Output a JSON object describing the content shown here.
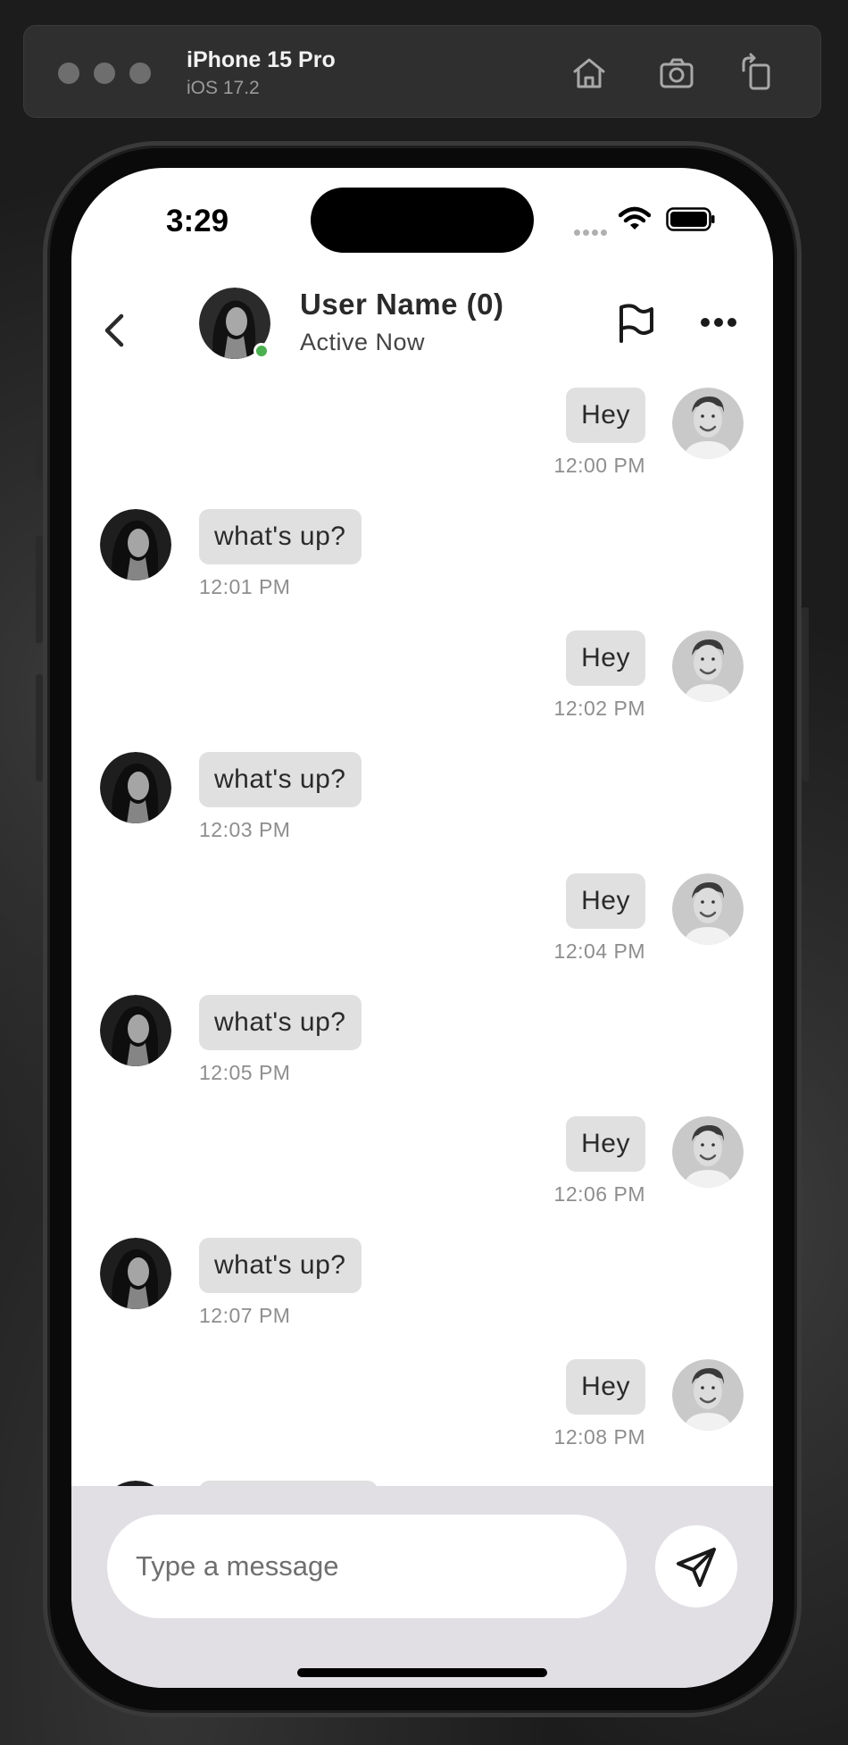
{
  "simulator": {
    "device_name": "iPhone 15 Pro",
    "os_version": "iOS 17.2",
    "icons": [
      "home-icon",
      "screenshot-icon",
      "rotate-icon"
    ]
  },
  "status_bar": {
    "time": "3:29",
    "icons": [
      "signal-icon",
      "wifi-icon",
      "battery-icon"
    ]
  },
  "chat_header": {
    "user_name": "User Name (0)",
    "status": "Active Now",
    "online_color": "#4caf50",
    "icons": [
      "back-chevron-icon",
      "flag-icon",
      "more-options-icon"
    ]
  },
  "messages": [
    {
      "direction": "outgoing",
      "text": "Hey",
      "time": "12:00 PM"
    },
    {
      "direction": "incoming",
      "text": "what's up?",
      "time": "12:01 PM"
    },
    {
      "direction": "outgoing",
      "text": "Hey",
      "time": "12:02 PM"
    },
    {
      "direction": "incoming",
      "text": "what's up?",
      "time": "12:03 PM"
    },
    {
      "direction": "outgoing",
      "text": "Hey",
      "time": "12:04 PM"
    },
    {
      "direction": "incoming",
      "text": "what's up?",
      "time": "12:05 PM"
    },
    {
      "direction": "outgoing",
      "text": "Hey",
      "time": "12:06 PM"
    },
    {
      "direction": "incoming",
      "text": "what's up?",
      "time": "12:07 PM"
    },
    {
      "direction": "outgoing",
      "text": "Hey",
      "time": "12:08 PM"
    }
  ],
  "composer": {
    "placeholder": "Type a message",
    "value": "",
    "send_icon": "send-icon"
  },
  "colors": {
    "bubble": "#e0e0e0",
    "composer_background": "#e1dfe4",
    "timestamp": "#8e8e8e"
  }
}
